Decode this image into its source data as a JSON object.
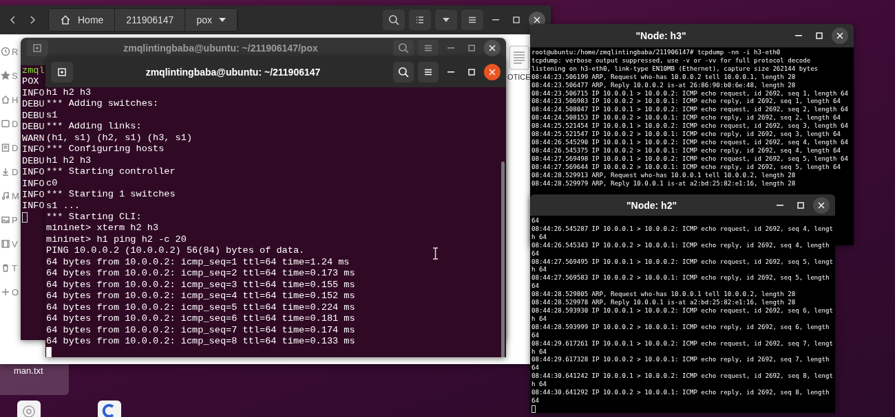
{
  "file_manager": {
    "path": [
      {
        "label": "Home",
        "kind": "home"
      },
      {
        "label": "211906147",
        "kind": "folder"
      },
      {
        "label": "pox",
        "kind": "dropdown"
      }
    ],
    "sidebar": [
      {
        "label": "R",
        "kind": "recent"
      },
      {
        "label": "S",
        "kind": "starred"
      },
      {
        "label": "H",
        "kind": "home"
      },
      {
        "label": "D",
        "kind": "desktop"
      },
      {
        "label": "D",
        "kind": "documents"
      },
      {
        "label": "D",
        "kind": "downloads"
      },
      {
        "label": "M",
        "kind": "music"
      },
      {
        "label": "P",
        "kind": "pictures"
      },
      {
        "label": "V",
        "kind": "videos"
      },
      {
        "label": "T",
        "kind": "trash"
      },
      {
        "label": "O",
        "kind": "other"
      }
    ],
    "files": [
      {
        "label": "OTICE"
      }
    ]
  },
  "terminals": [
    {
      "title": "zmqlintingbaba@ubuntu: ~/211906147/pox",
      "active": false,
      "lines": [
        {
          "text": "zmql",
          "kind": "prompt"
        },
        {
          "text": "POX",
          "kind": "plain"
        },
        {
          "text": "INFO",
          "kind": "plain"
        },
        {
          "text": "DEBU",
          "kind": "plain"
        },
        {
          "text": "DEBU",
          "kind": "plain"
        },
        {
          "text": "DEBU",
          "kind": "plain"
        },
        {
          "text": "WARN",
          "kind": "plain"
        },
        {
          "text": "INFO",
          "kind": "plain"
        },
        {
          "text": "DEBU",
          "kind": "plain"
        },
        {
          "text": "INFO",
          "kind": "plain"
        },
        {
          "text": "INFO",
          "kind": "plain"
        },
        {
          "text": "INFO",
          "kind": "plain"
        },
        {
          "text": "INFO",
          "kind": "plain"
        }
      ]
    },
    {
      "title": "zmqlintingbaba@ubuntu: ~/211906147",
      "active": true,
      "lines": [
        {
          "text": "h1 h2 h3",
          "kind": "plain"
        },
        {
          "text": "*** Adding switches:",
          "kind": "plain"
        },
        {
          "text": "s1",
          "kind": "plain"
        },
        {
          "text": "*** Adding links:",
          "kind": "plain"
        },
        {
          "text": "(h1, s1) (h2, s1) (h3, s1)",
          "kind": "plain"
        },
        {
          "text": "*** Configuring hosts",
          "kind": "plain"
        },
        {
          "text": "h1 h2 h3",
          "kind": "plain"
        },
        {
          "text": "*** Starting controller",
          "kind": "plain"
        },
        {
          "text": "c0",
          "kind": "plain"
        },
        {
          "text": "*** Starting 1 switches",
          "kind": "plain"
        },
        {
          "text": "s1 ...",
          "kind": "plain"
        },
        {
          "text": "*** Starting CLI:",
          "kind": "plain"
        },
        {
          "text": "mininet> xterm h2 h3",
          "kind": "plain"
        },
        {
          "text": "mininet> h1 ping h2 -c 20",
          "kind": "plain"
        },
        {
          "text": "PING 10.0.0.2 (10.0.0.2) 56(84) bytes of data.",
          "kind": "plain"
        },
        {
          "text": "64 bytes from 10.0.0.2: icmp_seq=1 ttl=64 time=1.24 ms",
          "kind": "plain"
        },
        {
          "text": "64 bytes from 10.0.0.2: icmp_seq=2 ttl=64 time=0.173 ms",
          "kind": "plain"
        },
        {
          "text": "64 bytes from 10.0.0.2: icmp_seq=3 ttl=64 time=0.155 ms",
          "kind": "plain"
        },
        {
          "text": "64 bytes from 10.0.0.2: icmp_seq=4 ttl=64 time=0.152 ms",
          "kind": "plain"
        },
        {
          "text": "64 bytes from 10.0.0.2: icmp_seq=5 ttl=64 time=0.224 ms",
          "kind": "plain"
        },
        {
          "text": "64 bytes from 10.0.0.2: icmp_seq=6 ttl=64 time=0.181 ms",
          "kind": "plain"
        },
        {
          "text": "64 bytes from 10.0.0.2: icmp_seq=7 ttl=64 time=0.174 ms",
          "kind": "plain"
        },
        {
          "text": "64 bytes from 10.0.0.2: icmp_seq=8 ttl=64 time=0.133 ms",
          "kind": "plain"
        }
      ]
    }
  ],
  "xterms": [
    {
      "title": "\"Node: h3\"",
      "lines": [
        "root@ubuntu:/home/zmqlintingbaba/211906147# tcpdump -nn -i h3-eth0",
        "tcpdump: verbose output suppressed, use -v or -vv for full protocol decode",
        "listening on h3-eth0, link-type EN10MB (Ethernet), capture size 262144 bytes",
        "08:44:23.506199 ARP, Request who-has 10.0.0.2 tell 10.0.0.1, length 28",
        "08:44:23.506477 ARP, Reply 10.0.0.2 is-at 26:86:90:b0:6e:48, length 28",
        "08:44:23.506715 IP 10.0.0.1 > 10.0.0.2: ICMP echo request, id 2692, seq 1, length 64",
        "08:44:23.506983 IP 10.0.0.2 > 10.0.0.1: ICMP echo reply, id 2692, seq 1, length 64",
        "08:44:24.508047 IP 10.0.0.1 > 10.0.0.2: ICMP echo request, id 2692, seq 2, length 64",
        "08:44:24.508153 IP 10.0.0.2 > 10.0.0.1: ICMP echo reply, id 2692, seq 2, length 64",
        "08:44:25.521454 IP 10.0.0.1 > 10.0.0.2: ICMP echo request, id 2692, seq 3, length 64",
        "08:44:25.521547 IP 10.0.0.2 > 10.0.0.1: ICMP echo reply, id 2692, seq 3, length 64",
        "08:44:26.545290 IP 10.0.0.1 > 10.0.0.2: ICMP echo request, id 2692, seq 4, length 64",
        "08:44:26.545375 IP 10.0.0.2 > 10.0.0.1: ICMP echo reply, id 2692, seq 4, length 64",
        "08:44:27.569498 IP 10.0.0.1 > 10.0.0.2: ICMP echo request, id 2692, seq 5, length 64",
        "08:44:27.569644 IP 10.0.0.2 > 10.0.0.1: ICMP echo reply, id 2692, seq 5, length 64",
        "08:44:28.529913 ARP, Request who-has 10.0.0.1 tell 10.0.0.2, length 28",
        "08:44:28.529979 ARP, Reply 10.0.0.1 is-at a2:bd:25:82:e1:16, length 28"
      ]
    },
    {
      "title": "\"Node: h2\"",
      "lines": [
        "64",
        "08:44:26.545287 IP 10.0.0.1 > 10.0.0.2: ICMP echo request, id 2692, seq 4, lengt",
        "h 64",
        "08:44:26.545343 IP 10.0.0.2 > 10.0.0.1: ICMP echo reply, id 2692, seq 4, length",
        "64",
        "08:44:27.569495 IP 10.0.0.1 > 10.0.0.2: ICMP echo request, id 2692, seq 5, lengt",
        "h 64",
        "08:44:27.569583 IP 10.0.0.2 > 10.0.0.1: ICMP echo reply, id 2692, seq 5, length",
        "64",
        "08:44:28.529805 ARP, Request who-has 10.0.0.1 tell 10.0.0.2, length 28",
        "08:44:28.529978 ARP, Reply 10.0.0.1 is-at a2:bd:25:82:e1:16, length 28",
        "08:44:28.593930 IP 10.0.0.1 > 10.0.0.2: ICMP echo request, id 2692, seq 6, lengt",
        "h 64",
        "08:44:28.593999 IP 10.0.0.2 > 10.0.0.1: ICMP echo reply, id 2692, seq 6, length",
        "64",
        "08:44:29.617261 IP 10.0.0.1 > 10.0.0.2: ICMP echo request, id 2692, seq 7, lengt",
        "h 64",
        "08:44:29.617328 IP 10.0.0.2 > 10.0.0.1: ICMP echo reply, id 2692, seq 7, length",
        "64",
        "08:44:30.641242 IP 10.0.0.1 > 10.0.0.2: ICMP echo request, id 2692, seq 8, lengt",
        "h 64",
        "08:44:30.641292 IP 10.0.0.2 > 10.0.0.1: ICMP echo reply, id 2692, seq 8, length",
        "64"
      ]
    }
  ],
  "desktop": {
    "items": [
      {
        "label": "man.txt",
        "selected": true
      }
    ]
  }
}
